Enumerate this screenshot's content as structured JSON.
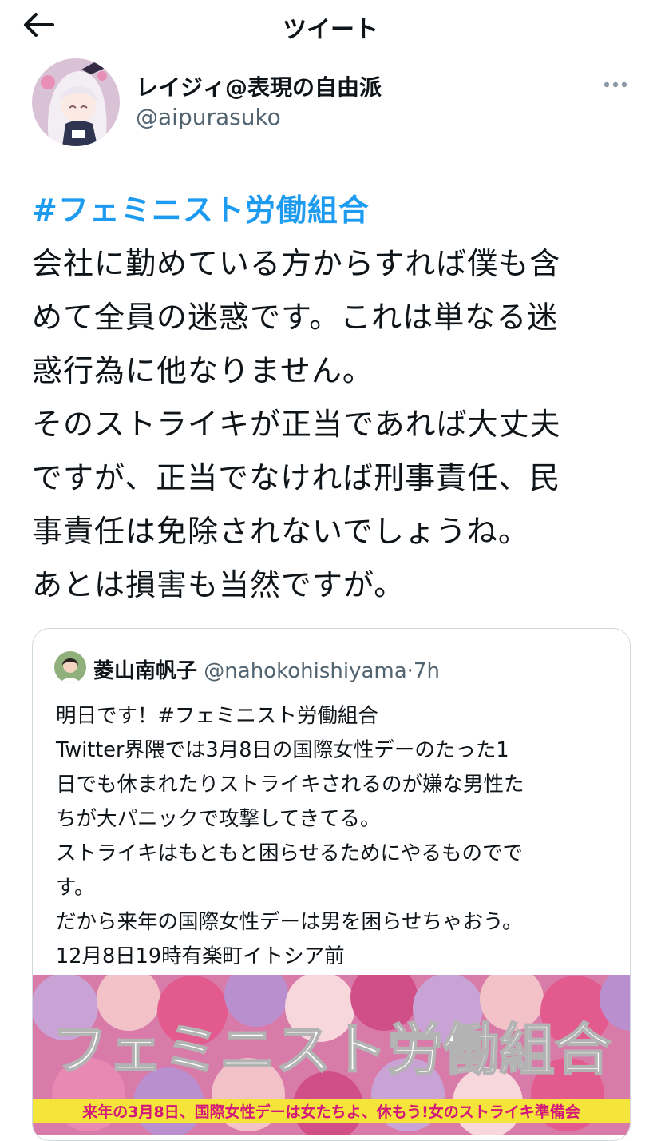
{
  "header": {
    "title": "ツイート"
  },
  "author": {
    "name": "レイジィ@表現の自由派",
    "handle": "@aipurasuko"
  },
  "tweet": {
    "hashtag": "#フェミニスト労働組合",
    "lines": [
      "会社に勤めている方からすれば僕も含",
      "めて全員の迷惑です。これは単なる迷",
      "惑行為に他なりません。",
      "そのストライキが正当であれば大丈夫",
      "ですが、正当でなければ刑事責任、民",
      "事責任は免除されないでしょうね。",
      "あとは損害も当然ですが。"
    ]
  },
  "quoted": {
    "name": "菱山南帆子",
    "handle": "@nahokohishiyama",
    "dot": "·",
    "time": "7h",
    "lines": [
      "明日です！#フェミニスト労働組合",
      "Twitter界隈では3月8日の国際女性デーのたった1",
      "日でも休まれたりストライキされるのが嫌な男性た",
      "ちが大パニックで攻撃してきてる。",
      "ストライキはもともと困らせるためにやるものでで",
      "す。",
      "だから来年の国際女性デーは男を困らせちゃおう。",
      "12月8日19時有楽町イトシア前"
    ],
    "image": {
      "title": "フェミニスト労働組合",
      "subtitle": "来年の3月8日、国際女性デーは女たちよ、休もう!女のストライキ準備会"
    }
  },
  "colors": {
    "hashtag": "#1d9bf0",
    "secondary": "#536471",
    "border": "#cfd9de",
    "banner_strip": "#f5e43a"
  }
}
